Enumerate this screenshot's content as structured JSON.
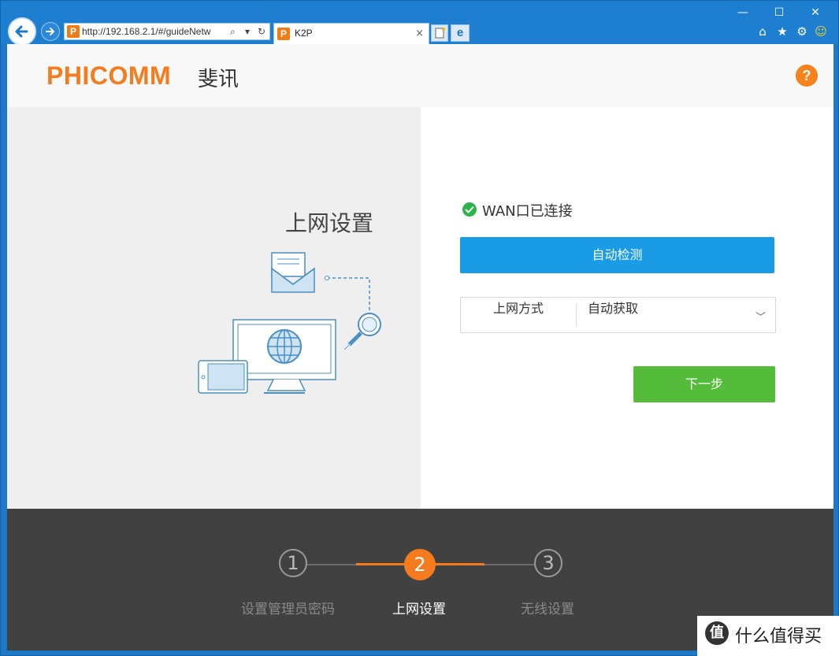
{
  "browser": {
    "address": "http://192.168.2.1/#/guideNetw",
    "tab_title": "K2P",
    "tab_close": "×",
    "favicon_letter": "P",
    "ie_letter": "e"
  },
  "header": {
    "logo": "PHICOMM",
    "logo_cn": "斐讯",
    "help": "?"
  },
  "left": {
    "title": "上网设置"
  },
  "right": {
    "wan_status": "WAN口已连接",
    "detect_button": "自动检测",
    "mode_label": "上网方式",
    "mode_value": "自动获取",
    "next_button": "下一步"
  },
  "steps": [
    {
      "num": "1",
      "label": "设置管理员密码",
      "active": false
    },
    {
      "num": "2",
      "label": "上网设置",
      "active": true
    },
    {
      "num": "3",
      "label": "无线设置",
      "active": false
    }
  ],
  "watermark": {
    "icon": "值",
    "text": "什么值得买"
  },
  "colors": {
    "brand_orange": "#f47c1e",
    "detect_blue": "#1a9be6",
    "next_green": "#55bb3a",
    "footer_dark": "#414141"
  }
}
